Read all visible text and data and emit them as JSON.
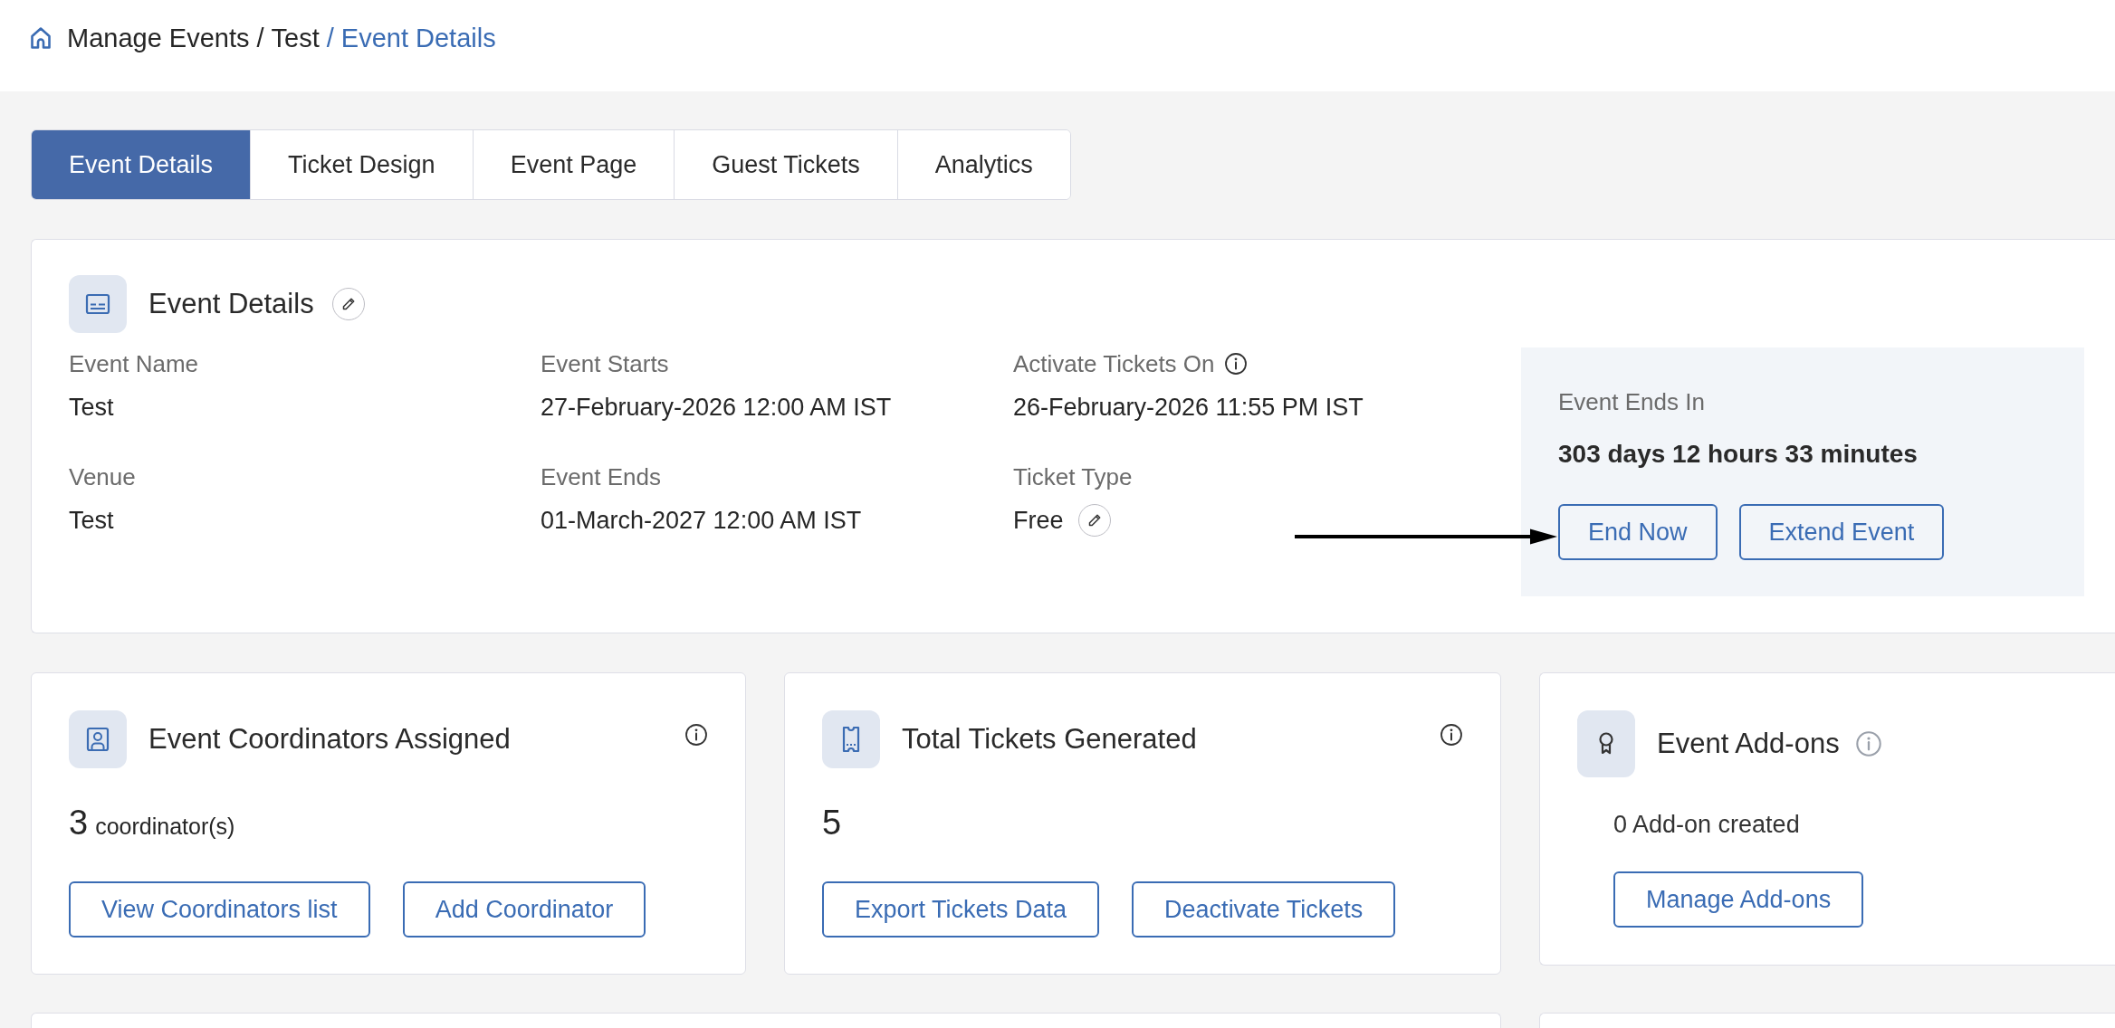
{
  "breadcrumb": {
    "separator": "/",
    "items": [
      {
        "label": "Manage Events",
        "current": false
      },
      {
        "label": "Test",
        "current": false
      },
      {
        "label": "Event Details",
        "current": true
      }
    ]
  },
  "tabs": [
    {
      "label": "Event Details",
      "selected": true
    },
    {
      "label": "Ticket Design",
      "selected": false
    },
    {
      "label": "Event Page",
      "selected": false
    },
    {
      "label": "Guest Tickets",
      "selected": false
    },
    {
      "label": "Analytics",
      "selected": false
    }
  ],
  "event_details": {
    "title": "Event Details",
    "editable": true,
    "fields": [
      {
        "label": "Event Name",
        "value": "Test",
        "info": false,
        "editable": false
      },
      {
        "label": "Event Starts",
        "value": "27-February-2026 12:00 AM IST",
        "info": false,
        "editable": false
      },
      {
        "label": "Activate Tickets On",
        "value": "26-February-2026 11:55 PM IST",
        "info": true,
        "editable": false
      },
      {
        "label": "Venue",
        "value": "Test",
        "info": false,
        "editable": false
      },
      {
        "label": "Event Ends",
        "value": "01-March-2027 12:00 AM IST",
        "info": false,
        "editable": false
      },
      {
        "label": "Ticket Type",
        "value": "Free",
        "info": false,
        "editable": true
      }
    ],
    "ends_in": {
      "label": "Event Ends In",
      "value": "303 days 12 hours 33 minutes",
      "buttons": [
        "End Now",
        "Extend Event"
      ]
    }
  },
  "cards": [
    {
      "kind": "coordinators",
      "title": "Event Coordinators Assigned",
      "info": true,
      "count": "3",
      "unit": "coordinator(s)",
      "buttons": [
        "View Coordinators list",
        "Add Coordinator"
      ]
    },
    {
      "kind": "tickets",
      "title": "Total Tickets Generated",
      "info": true,
      "count": "5",
      "buttons": [
        "Export Tickets Data",
        "Deactivate Tickets"
      ]
    },
    {
      "kind": "addons",
      "title": "Event Add-ons",
      "info": true,
      "summary": "0 Add-on created",
      "buttons": [
        "Manage Add-ons"
      ]
    }
  ]
}
